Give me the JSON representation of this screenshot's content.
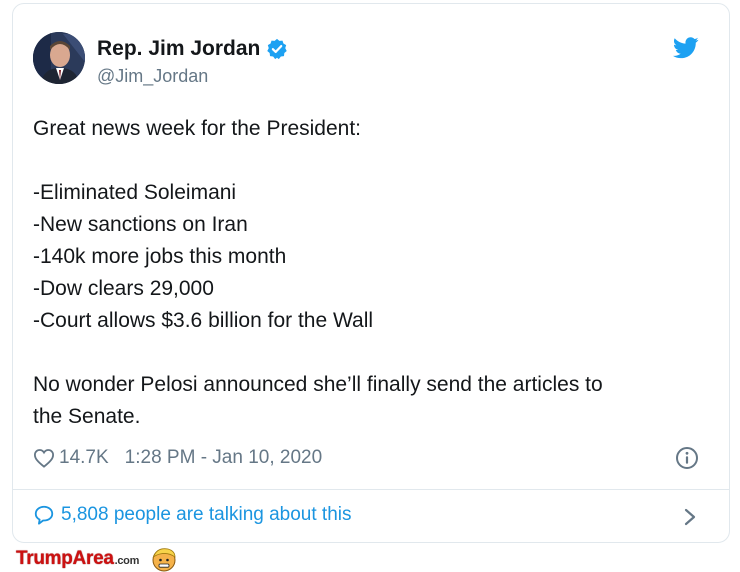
{
  "tweet": {
    "display_name": "Rep. Jim Jordan",
    "handle": "@Jim_Jordan",
    "text_lines": [
      "Great news week for the President:",
      "",
      "-Eliminated Soleimani",
      "-New sanctions on Iran",
      "-140k more jobs this month",
      "-Dow clears 29,000",
      "-Court allows $3.6 billion for the Wall",
      "",
      "No wonder Pelosi announced she’ll finally send the articles to",
      "the Senate."
    ],
    "likes": "14.7K",
    "timestamp": "1:28 PM - Jan 10, 2020",
    "talking": "5,808 people are talking about this"
  },
  "icons": {
    "verified": "verified-badge-icon",
    "brand": "twitter-bird-icon",
    "like": "heart-icon",
    "info": "info-icon",
    "reply": "speech-bubble-icon",
    "more": "chevron-right-icon"
  },
  "colors": {
    "twitter_blue": "#1da1f2",
    "link_blue": "#1b95e0",
    "muted": "#657786",
    "text": "#14171a",
    "border": "#e1e8ed",
    "watermark_red": "#cc1111"
  },
  "watermark": {
    "brand": "TrumpArea",
    "suffix": ".com"
  }
}
